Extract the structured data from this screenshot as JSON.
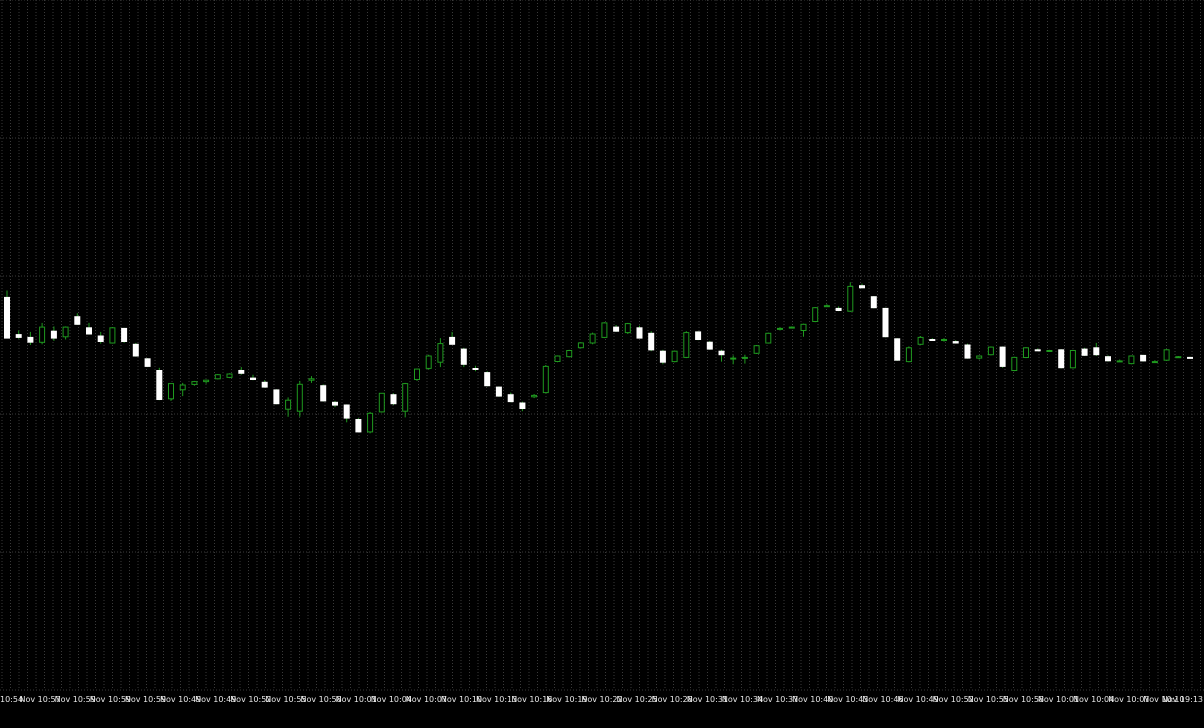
{
  "colors": {
    "background": "#000000",
    "grid": "#3a3a3a",
    "bull_body": "#000000",
    "bull_outline": "#1f9a1f",
    "bear_body": "#ffffff",
    "wick": "#1f9a1f",
    "axis_text": "#e8e8e8"
  },
  "chart_data": {
    "type": "candlestick",
    "grid": true,
    "ylim": [
      0,
      100
    ],
    "x_tick_labels": [
      "10:54",
      "Nov 10:57",
      "Nov 10:59",
      "Nov 10:59",
      "Nov 10:59",
      "Nov 10:49",
      "Nov 10:49",
      "Nov 10:52",
      "Nov 10:55",
      "Nov 10:58",
      "Nov 10:01",
      "Nov 10:04",
      "Nov 10:07",
      "Nov 10:10",
      "Nov 10:13",
      "Nov 10:16",
      "Nov 10:19",
      "Nov 10:22",
      "Nov 10:25",
      "Nov 10:28",
      "Nov 10:31",
      "Nov 10:34",
      "Nov 10:37",
      "Nov 10:40",
      "Nov 10:43",
      "Nov 10:46",
      "Nov 10:49",
      "Nov 10:52",
      "Nov 10:55",
      "Nov 10:58",
      "Nov 10:01",
      "Nov 10:04",
      "Nov 10:07",
      "Nov 10:10",
      "Nov 19:13"
    ],
    "candles": [
      {
        "o": 56.9,
        "h": 57.9,
        "l": 51.0,
        "c": 51.0
      },
      {
        "o": 51.5,
        "h": 52.1,
        "l": 50.9,
        "c": 51.1
      },
      {
        "o": 51.1,
        "h": 51.9,
        "l": 50.0,
        "c": 50.4
      },
      {
        "o": 50.4,
        "h": 53.2,
        "l": 50.1,
        "c": 52.6
      },
      {
        "o": 52.0,
        "h": 52.7,
        "l": 50.6,
        "c": 51.0
      },
      {
        "o": 51.2,
        "h": 52.7,
        "l": 50.8,
        "c": 52.6
      },
      {
        "o": 54.1,
        "h": 54.6,
        "l": 52.9,
        "c": 53.0
      },
      {
        "o": 52.5,
        "h": 53.2,
        "l": 51.5,
        "c": 51.6
      },
      {
        "o": 51.3,
        "h": 51.9,
        "l": 50.2,
        "c": 50.5
      },
      {
        "o": 50.3,
        "h": 52.6,
        "l": 50.2,
        "c": 52.5
      },
      {
        "o": 52.4,
        "h": 52.5,
        "l": 50.3,
        "c": 50.5
      },
      {
        "o": 50.1,
        "h": 50.3,
        "l": 48.3,
        "c": 48.4
      },
      {
        "o": 48.0,
        "h": 48.1,
        "l": 46.8,
        "c": 46.9
      },
      {
        "o": 46.3,
        "h": 46.7,
        "l": 42.0,
        "c": 42.1
      },
      {
        "o": 42.2,
        "h": 44.4,
        "l": 41.9,
        "c": 44.4
      },
      {
        "o": 43.5,
        "h": 44.5,
        "l": 42.6,
        "c": 44.2
      },
      {
        "o": 44.3,
        "h": 44.8,
        "l": 44.1,
        "c": 44.7
      },
      {
        "o": 44.7,
        "h": 45.0,
        "l": 44.4,
        "c": 44.9
      },
      {
        "o": 45.1,
        "h": 45.8,
        "l": 45.0,
        "c": 45.7
      },
      {
        "o": 45.3,
        "h": 45.9,
        "l": 45.2,
        "c": 45.8
      },
      {
        "o": 46.3,
        "h": 46.8,
        "l": 45.7,
        "c": 45.9
      },
      {
        "o": 45.2,
        "h": 45.7,
        "l": 44.9,
        "c": 45.0
      },
      {
        "o": 44.6,
        "h": 44.9,
        "l": 43.8,
        "c": 43.9
      },
      {
        "o": 43.5,
        "h": 43.6,
        "l": 41.4,
        "c": 41.5
      },
      {
        "o": 40.7,
        "h": 42.4,
        "l": 39.6,
        "c": 42.0
      },
      {
        "o": 40.4,
        "h": 44.8,
        "l": 39.6,
        "c": 44.3
      },
      {
        "o": 44.9,
        "h": 45.5,
        "l": 44.5,
        "c": 45.1
      },
      {
        "o": 44.1,
        "h": 44.3,
        "l": 41.8,
        "c": 41.9
      },
      {
        "o": 41.7,
        "h": 41.9,
        "l": 41.0,
        "c": 41.3
      },
      {
        "o": 41.3,
        "h": 41.4,
        "l": 38.8,
        "c": 39.4
      },
      {
        "o": 39.2,
        "h": 39.4,
        "l": 37.4,
        "c": 37.4
      },
      {
        "o": 37.4,
        "h": 40.3,
        "l": 37.2,
        "c": 40.1
      },
      {
        "o": 40.3,
        "h": 43.0,
        "l": 40.2,
        "c": 43.0
      },
      {
        "o": 42.8,
        "h": 43.0,
        "l": 41.3,
        "c": 41.5
      },
      {
        "o": 40.4,
        "h": 44.5,
        "l": 39.5,
        "c": 44.4
      },
      {
        "o": 45.0,
        "h": 46.6,
        "l": 44.8,
        "c": 46.5
      },
      {
        "o": 46.6,
        "h": 48.6,
        "l": 46.4,
        "c": 48.4
      },
      {
        "o": 47.5,
        "h": 51.0,
        "l": 46.8,
        "c": 50.2
      },
      {
        "o": 51.1,
        "h": 51.9,
        "l": 50.1,
        "c": 50.1
      },
      {
        "o": 49.4,
        "h": 49.6,
        "l": 46.8,
        "c": 47.2
      },
      {
        "o": 46.6,
        "h": 47.0,
        "l": 46.2,
        "c": 46.5
      },
      {
        "o": 46.0,
        "h": 46.2,
        "l": 44.0,
        "c": 44.1
      },
      {
        "o": 43.9,
        "h": 44.0,
        "l": 42.5,
        "c": 42.6
      },
      {
        "o": 42.8,
        "h": 43.1,
        "l": 41.7,
        "c": 41.8
      },
      {
        "o": 41.6,
        "h": 41.8,
        "l": 40.4,
        "c": 40.8
      },
      {
        "o": 42.5,
        "h": 42.9,
        "l": 42.3,
        "c": 42.7
      },
      {
        "o": 43.1,
        "h": 47.1,
        "l": 43.0,
        "c": 46.9
      },
      {
        "o": 47.6,
        "h": 48.5,
        "l": 47.5,
        "c": 48.4
      },
      {
        "o": 48.3,
        "h": 49.3,
        "l": 48.2,
        "c": 49.2
      },
      {
        "o": 49.6,
        "h": 50.4,
        "l": 49.5,
        "c": 50.3
      },
      {
        "o": 50.3,
        "h": 51.8,
        "l": 50.1,
        "c": 51.6
      },
      {
        "o": 51.1,
        "h": 53.3,
        "l": 51.0,
        "c": 53.2
      },
      {
        "o": 52.6,
        "h": 52.9,
        "l": 51.9,
        "c": 52.0
      },
      {
        "o": 51.8,
        "h": 53.2,
        "l": 51.6,
        "c": 53.1
      },
      {
        "o": 52.5,
        "h": 52.8,
        "l": 51.0,
        "c": 51.0
      },
      {
        "o": 51.7,
        "h": 52.0,
        "l": 49.1,
        "c": 49.3
      },
      {
        "o": 49.1,
        "h": 49.3,
        "l": 47.2,
        "c": 47.5
      },
      {
        "o": 47.6,
        "h": 49.2,
        "l": 47.5,
        "c": 49.1
      },
      {
        "o": 48.2,
        "h": 52.0,
        "l": 48.1,
        "c": 51.8
      },
      {
        "o": 51.9,
        "h": 52.0,
        "l": 50.7,
        "c": 50.8
      },
      {
        "o": 50.4,
        "h": 50.6,
        "l": 49.3,
        "c": 49.4
      },
      {
        "o": 49.1,
        "h": 49.3,
        "l": 47.6,
        "c": 48.6
      },
      {
        "o": 48.0,
        "h": 48.5,
        "l": 47.2,
        "c": 48.1
      },
      {
        "o": 48.1,
        "h": 48.6,
        "l": 47.3,
        "c": 48.2
      },
      {
        "o": 48.8,
        "h": 50.0,
        "l": 48.7,
        "c": 49.9
      },
      {
        "o": 50.3,
        "h": 51.8,
        "l": 50.2,
        "c": 51.7
      },
      {
        "o": 52.3,
        "h": 52.6,
        "l": 52.1,
        "c": 52.4
      },
      {
        "o": 52.5,
        "h": 52.7,
        "l": 52.4,
        "c": 52.6
      },
      {
        "o": 52.1,
        "h": 53.1,
        "l": 51.2,
        "c": 53.0
      },
      {
        "o": 53.4,
        "h": 55.5,
        "l": 53.3,
        "c": 55.4
      },
      {
        "o": 55.6,
        "h": 55.9,
        "l": 55.5,
        "c": 55.7
      },
      {
        "o": 55.3,
        "h": 55.6,
        "l": 54.9,
        "c": 55.0
      },
      {
        "o": 54.9,
        "h": 59.1,
        "l": 54.8,
        "c": 58.5
      },
      {
        "o": 58.6,
        "h": 58.9,
        "l": 58.2,
        "c": 58.3
      },
      {
        "o": 57.0,
        "h": 57.1,
        "l": 55.3,
        "c": 55.4
      },
      {
        "o": 55.3,
        "h": 55.4,
        "l": 51.1,
        "c": 51.2
      },
      {
        "o": 50.9,
        "h": 51.0,
        "l": 47.7,
        "c": 47.8
      },
      {
        "o": 47.6,
        "h": 49.8,
        "l": 47.5,
        "c": 49.6
      },
      {
        "o": 50.1,
        "h": 51.3,
        "l": 50.0,
        "c": 51.1
      },
      {
        "o": 50.8,
        "h": 51.0,
        "l": 50.6,
        "c": 50.7
      },
      {
        "o": 50.7,
        "h": 51.0,
        "l": 50.5,
        "c": 50.8
      },
      {
        "o": 50.5,
        "h": 50.7,
        "l": 50.2,
        "c": 50.3
      },
      {
        "o": 50.0,
        "h": 50.2,
        "l": 48.0,
        "c": 48.1
      },
      {
        "o": 48.1,
        "h": 48.5,
        "l": 47.9,
        "c": 48.4
      },
      {
        "o": 48.6,
        "h": 49.8,
        "l": 48.5,
        "c": 49.7
      },
      {
        "o": 49.7,
        "h": 49.8,
        "l": 46.7,
        "c": 46.9
      },
      {
        "o": 46.3,
        "h": 48.3,
        "l": 46.2,
        "c": 48.2
      },
      {
        "o": 48.2,
        "h": 49.7,
        "l": 48.1,
        "c": 49.6
      },
      {
        "o": 49.3,
        "h": 49.5,
        "l": 49.1,
        "c": 49.2
      },
      {
        "o": 49.2,
        "h": 49.3,
        "l": 49.1,
        "c": 49.2
      },
      {
        "o": 49.3,
        "h": 49.4,
        "l": 46.6,
        "c": 46.7
      },
      {
        "o": 46.7,
        "h": 49.3,
        "l": 46.6,
        "c": 49.2
      },
      {
        "o": 49.4,
        "h": 49.6,
        "l": 48.4,
        "c": 48.5
      },
      {
        "o": 49.6,
        "h": 50.3,
        "l": 48.4,
        "c": 48.6
      },
      {
        "o": 48.3,
        "h": 48.5,
        "l": 47.6,
        "c": 47.7
      },
      {
        "o": 47.7,
        "h": 47.9,
        "l": 47.6,
        "c": 47.7
      },
      {
        "o": 47.3,
        "h": 48.5,
        "l": 47.2,
        "c": 48.4
      },
      {
        "o": 48.5,
        "h": 48.6,
        "l": 47.6,
        "c": 47.7
      },
      {
        "o": 47.6,
        "h": 47.8,
        "l": 47.5,
        "c": 47.6
      },
      {
        "o": 47.8,
        "h": 49.4,
        "l": 47.7,
        "c": 49.3
      },
      {
        "o": 48.3,
        "h": 48.4,
        "l": 48.2,
        "c": 48.3
      },
      {
        "o": 48.2,
        "h": 48.3,
        "l": 48.0,
        "c": 48.1
      }
    ]
  }
}
